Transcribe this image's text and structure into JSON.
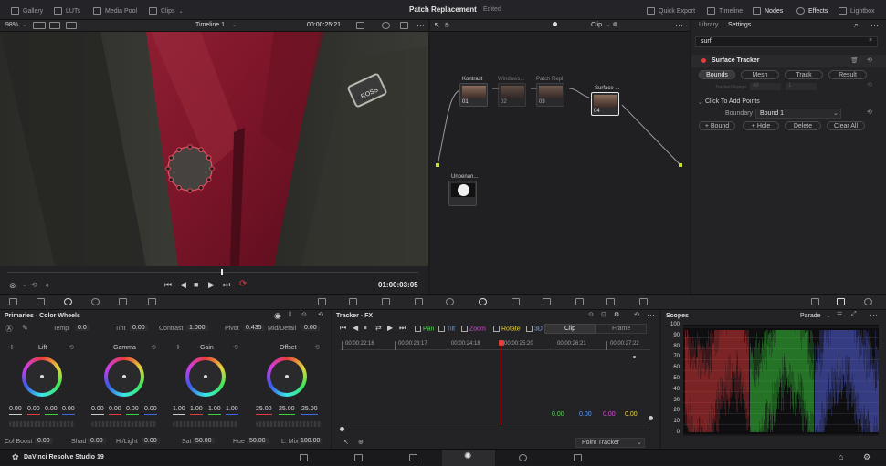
{
  "topbar": {
    "gallery": "Gallery",
    "luts": "LUTs",
    "media_pool": "Media Pool",
    "clips": "Clips",
    "title": "Patch Replacement",
    "status": "Edited",
    "quick_export": "Quick Export",
    "timeline": "Timeline",
    "nodes": "Nodes",
    "effects": "Effects",
    "lightbox": "Lightbox"
  },
  "viewer": {
    "zoom": "98%",
    "timeline_name": "Timeline 1",
    "timecode": "00:00:25:21",
    "current_time": "01:00:03:05",
    "badge_text": "ROSS"
  },
  "nodes": {
    "mode": "Clip",
    "items": [
      {
        "title": "Kontrast",
        "num": "01"
      },
      {
        "title": "Windows...",
        "num": "02"
      },
      {
        "title": "Patch Repl",
        "num": "03"
      },
      {
        "title": "Surface ...",
        "num": "04"
      }
    ],
    "unbenannt": "Unbenan..."
  },
  "fx": {
    "tab_library": "Library",
    "tab_settings": "Settings",
    "search_value": "surf",
    "effect_name": "Surface Tracker",
    "tabs": [
      "Bounds",
      "Mesh",
      "Track",
      "Result"
    ],
    "tracked_range_label": "Tracked Range",
    "range_start": "48",
    "range_end": "1",
    "click_to_add": "Click To Add Points",
    "boundary_label": "Boundary",
    "boundary_value": "Bound 1",
    "buttons": [
      "+ Bound",
      "+ Hole",
      "Delete",
      "Clear All"
    ]
  },
  "wheels": {
    "title": "Primaries - Color Wheels",
    "temp_label": "Temp",
    "temp_value": "0.0",
    "tint_label": "Tint",
    "tint_value": "0.00",
    "contrast_label": "Contrast",
    "contrast_value": "1.000",
    "pivot_label": "Pivot",
    "pivot_value": "0.435",
    "middetail_label": "Mid/Detail",
    "middetail_value": "0.00",
    "lift": {
      "name": "Lift",
      "values": [
        "0.00",
        "0.00",
        "0.00",
        "0.00"
      ]
    },
    "gamma": {
      "name": "Gamma",
      "values": [
        "0.00",
        "0.00",
        "0.00",
        "0.00"
      ]
    },
    "gain": {
      "name": "Gain",
      "values": [
        "1.00",
        "1.00",
        "1.00",
        "1.00"
      ]
    },
    "offset": {
      "name": "Offset",
      "values": [
        "25.00",
        "25.00",
        "25.00"
      ]
    },
    "colboost_label": "Col Boost",
    "colboost_value": "0.00",
    "shad_label": "Shad",
    "shad_value": "0.00",
    "hilight_label": "Hi/Light",
    "hilight_value": "0.00",
    "sat_label": "Sat",
    "sat_value": "50.00",
    "hue_label": "Hue",
    "hue_value": "50.00",
    "lmix_label": "L. Mix",
    "lmix_value": "100.00"
  },
  "tracker": {
    "title": "Tracker - FX",
    "pan": "Pan",
    "tilt": "Tilt",
    "zoom": "Zoom",
    "rotate": "Rotate",
    "threed": "3D",
    "clip": "Clip",
    "frame": "Frame",
    "ruler": [
      "00:00:22:16",
      "00:00:23:17",
      "00:00:24:18",
      "00:00:25:20",
      "00:00:26:21",
      "00:00:27:22"
    ],
    "values": [
      "0.00",
      "0.00",
      "0.00",
      "0.00"
    ],
    "point_tracker": "Point Tracker"
  },
  "scopes": {
    "title": "Scopes",
    "mode": "Parade",
    "scale": [
      "100",
      "90",
      "80",
      "70",
      "60",
      "50",
      "40",
      "30",
      "20",
      "10",
      "0"
    ]
  },
  "bottom": {
    "app_name": "DaVinci Resolve Studio 19"
  },
  "colors": {
    "accent_red": "#e23c3c",
    "pan": "#56d756",
    "tilt": "#5a9cff",
    "zoom": "#d84ad8",
    "rotate": "#e6d23c"
  }
}
